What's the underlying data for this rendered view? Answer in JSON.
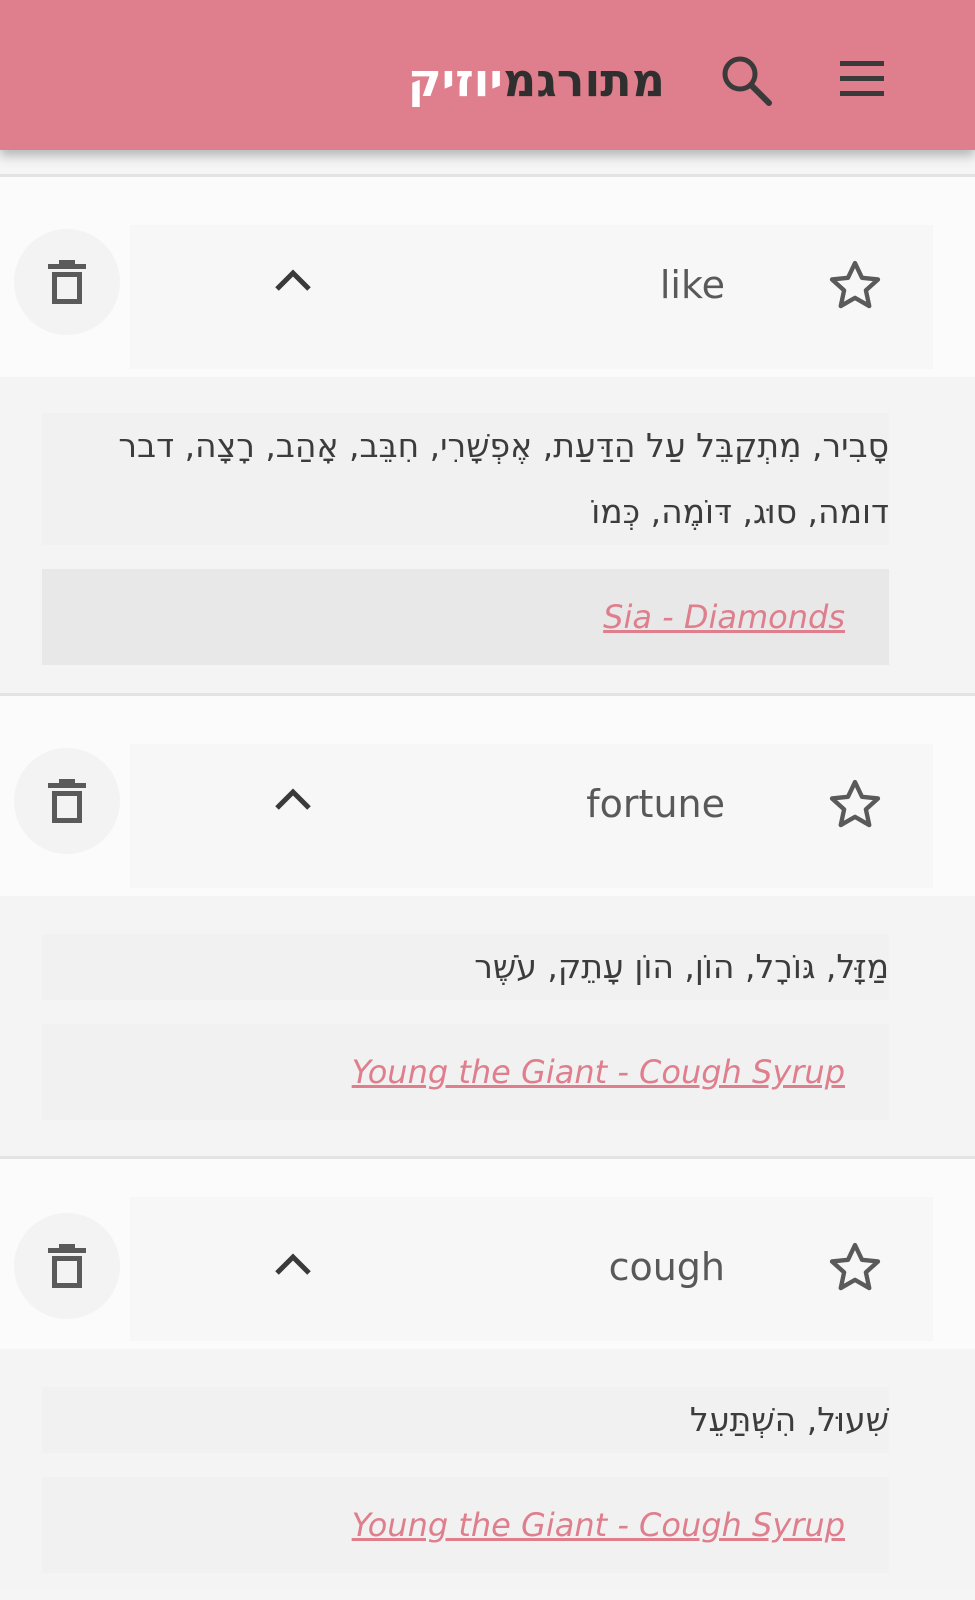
{
  "app": {
    "title_part1": "מתורגמ",
    "title_part2": "יוזיק",
    "menu_icon": "hamburger-menu-icon",
    "search_icon": "search-icon",
    "accent_color": "#df7e8c",
    "header_color": "#df7e8c",
    "link_color": "#df7e8c"
  },
  "entries": [
    {
      "word": "like",
      "translation": "סָבִיר, מִתְקַבֵּל עַל הַדַּעַת, אֶפְשָׁרִי, חִבֵּב, אָהַב, רָצָה, דבר דומה, סוּג, דּוֹמֶה, כְּמוֹ",
      "song": "Sia - Diamonds",
      "expanded": true,
      "starred": false
    },
    {
      "word": "fortune",
      "translation": "מַזָּל, גּוֹרָל, הוֹן, הוֹן עָתֵק, עֹשֶׁר",
      "song": "Young the Giant - Cough Syrup",
      "expanded": true,
      "starred": false
    },
    {
      "word": "cough",
      "translation": "שִׁעוּל, הִשְׁתַּעֵל",
      "song": "Young the Giant - Cough Syrup",
      "expanded": true,
      "starred": false
    }
  ]
}
